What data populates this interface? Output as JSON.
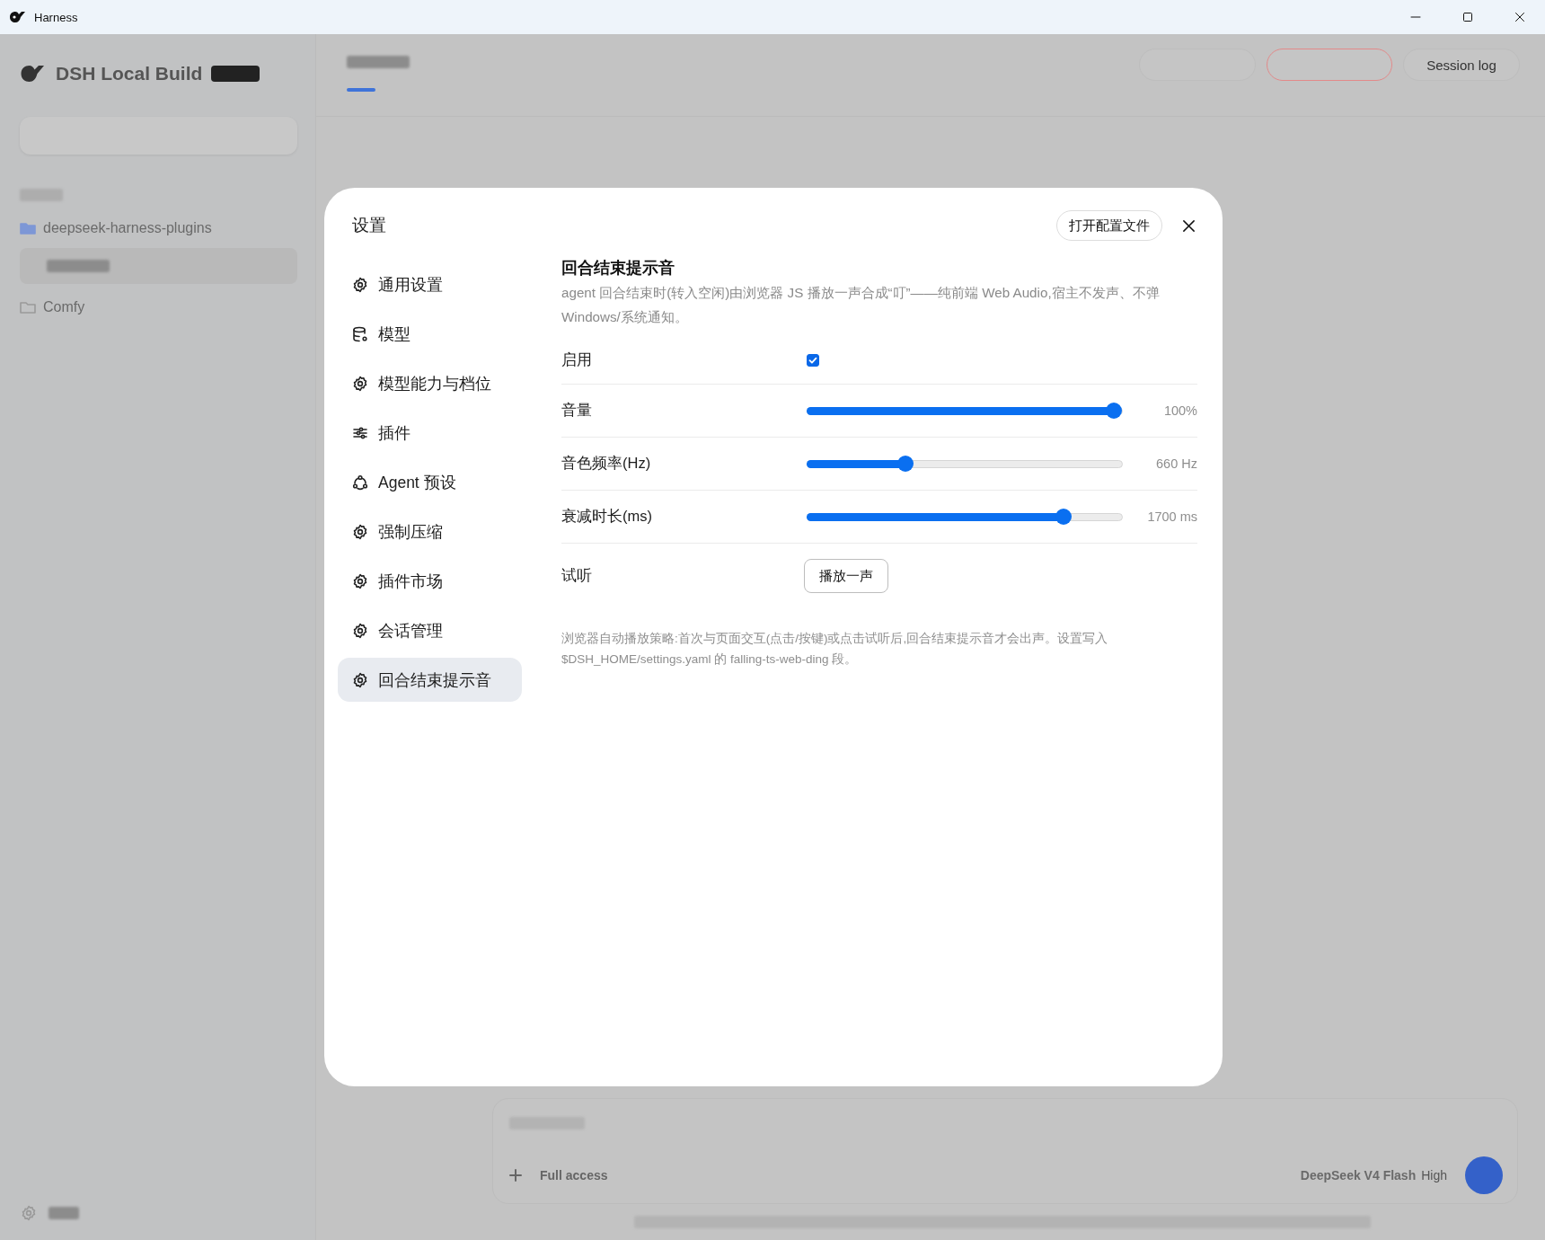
{
  "window": {
    "title": "Harness"
  },
  "background": {
    "app_name": "DSH Local Build",
    "workspaces": [
      {
        "name": "deepseek-harness-plugins",
        "kind": "folder-filled"
      },
      {
        "name": "Comfy",
        "kind": "folder-outline"
      }
    ],
    "top_button": "Session log",
    "composer": {
      "access": "Full access",
      "model": "DeepSeek V4 Flash",
      "effort": "High"
    }
  },
  "settings": {
    "title": "设置",
    "open_config": "打开配置文件",
    "nav": [
      {
        "label": "通用设置",
        "kind": "gear",
        "selected": false
      },
      {
        "label": "模型",
        "kind": "database",
        "selected": false
      },
      {
        "label": "模型能力与档位",
        "kind": "gear",
        "selected": false
      },
      {
        "label": "插件",
        "kind": "sliders",
        "selected": false
      },
      {
        "label": "Agent 预设",
        "kind": "agent",
        "selected": false
      },
      {
        "label": "强制压缩",
        "kind": "gear",
        "selected": false
      },
      {
        "label": "插件市场",
        "kind": "gear",
        "selected": false
      },
      {
        "label": "会话管理",
        "kind": "gear",
        "selected": false
      },
      {
        "label": "回合结束提示音",
        "kind": "gear",
        "selected": true
      }
    ],
    "section": {
      "title": "回合结束提示音",
      "description": "agent 回合结束时(转入空闲)由浏览器 JS 播放一声合成“叮”——纯前端 Web Audio,宿主不发声、不弹 Windows/系统通知。",
      "rows": [
        {
          "kind": "checkbox",
          "label": "启用",
          "checked": true
        },
        {
          "kind": "slider",
          "label": "音量",
          "level": 1,
          "reading": "100%"
        },
        {
          "kind": "slider",
          "label": "音色频率(Hz)",
          "level": 0.3,
          "reading": "660 Hz"
        },
        {
          "kind": "slider",
          "label": "衰减时长(ms)",
          "level": 0.83,
          "reading": "1700 ms"
        },
        {
          "kind": "button",
          "label": "试听",
          "button": "播放一声"
        }
      ],
      "note": "浏览器自动播放策略:首次与页面交互(点击/按键)或点击试听后,回合结束提示音才会出声。设置写入 $DSH_HOME/settings.yaml 的 falling-ts-web-ding 段。"
    }
  }
}
